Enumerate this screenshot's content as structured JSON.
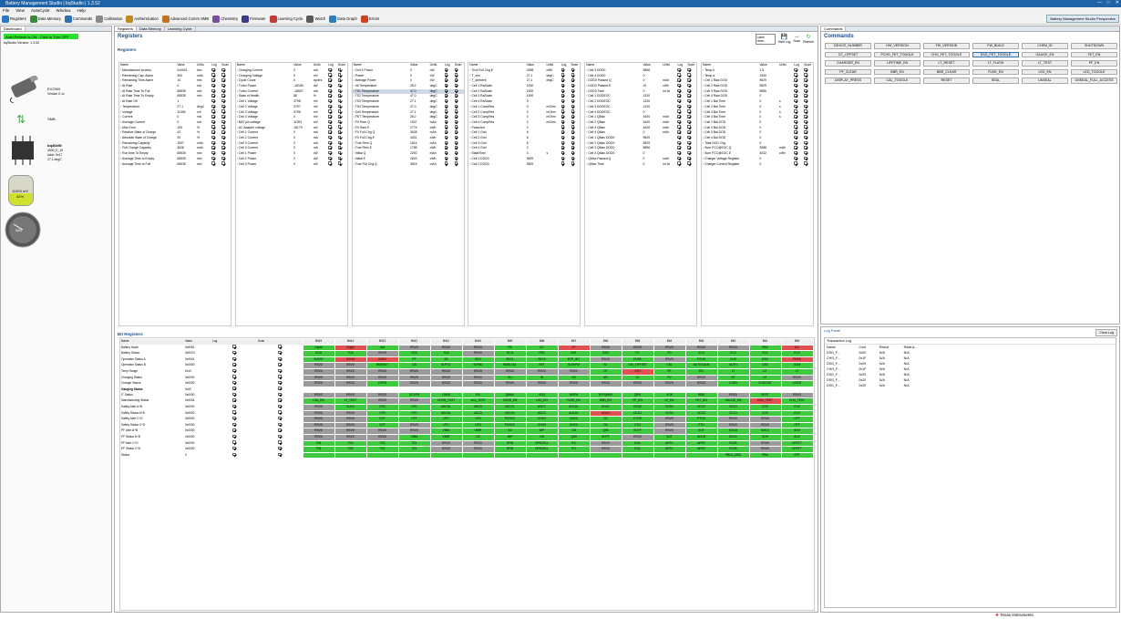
{
  "window": {
    "title": "Battery Management Studio | bqStudio | 1.3.52",
    "perspective": "Battery Management Studio Perspective"
  },
  "menu": [
    "File",
    "View",
    "AutoCycle",
    "Window",
    "Help"
  ],
  "toolbar": [
    {
      "label": "Registers",
      "color": "#2a78c8"
    },
    {
      "label": "Data Memory",
      "color": "#3b8a3b"
    },
    {
      "label": "Commands",
      "color": "#2f6fb0"
    },
    {
      "label": "Calibration",
      "color": "#8a8a8a"
    },
    {
      "label": "Authentication",
      "color": "#c08a1e"
    },
    {
      "label": "Advanced Comm SMB",
      "color": "#c07020"
    },
    {
      "label": "Chemistry",
      "color": "#7a4fa0"
    },
    {
      "label": "Firmware",
      "color": "#3a3a8a"
    },
    {
      "label": "Learning Cycle",
      "color": "#c03a3a"
    },
    {
      "label": "Watch",
      "color": "#5a5a5a"
    },
    {
      "label": "Data Graph",
      "color": "#2a80c0"
    },
    {
      "label": "Errors",
      "color": "#d04020"
    }
  ],
  "dashboard": {
    "tab": "Dashboard",
    "banner": "Auto Refresh is ON - Click to Turn OFF",
    "version": "bqStudio Version: 1.3.52",
    "device": "EV2300",
    "device_ver": "Version 0.1c",
    "smb": "SMB",
    "chip": "bq40z50",
    "chip_l1": "4500_0_15",
    "chip_l2": "Addr: 0x17",
    "chip_temp": "27.1 degC",
    "rsoc": "42%",
    "cap": "11393 mV",
    "gauge": "5000"
  },
  "main_tabs": [
    "Registers",
    "Data Memory",
    "Learning Cycle"
  ],
  "registers": {
    "title": "Registers",
    "section": "Registers",
    "bit_section": "Bit Registers",
    "actions": [
      "Label Here...",
      "Start Log",
      "Scan",
      "Refresh"
    ],
    "headers": [
      "Name",
      "Value",
      "Units",
      "Log",
      "Scan"
    ],
    "blocks": [
      [
        [
          "Manufacturer Access",
          "0x0041",
          "hex"
        ],
        [
          "Remaining Cap. Alarm",
          "300",
          "mAh"
        ],
        [
          "Remaining Time Alarm",
          "10",
          "min"
        ],
        [
          "At Rate",
          "0",
          "mA"
        ],
        [
          "At Rate Time To Full",
          "65535",
          "min"
        ],
        [
          "At Rate Time To Empty",
          "65535",
          "min"
        ],
        [
          "At Rate OK",
          "1",
          ""
        ],
        [
          "Temperature",
          "27.1",
          "degC"
        ],
        [
          "Voltage",
          "11394",
          "mV"
        ],
        [
          "Current",
          "0",
          "mA"
        ],
        [
          "Average Current",
          "0",
          "mA"
        ],
        [
          "Max Error",
          "100",
          "%"
        ],
        [
          "Relative State of Charge",
          "42",
          "%"
        ],
        [
          "Absolute State of Charge",
          "29",
          "%"
        ],
        [
          "Remaining Capacity",
          "1537",
          "mAh"
        ],
        [
          "Full Charge Capacity",
          "3628",
          "mAh"
        ],
        [
          "Run time To Empty",
          "65535",
          "min"
        ],
        [
          "Average Time to Empty",
          "65535",
          "min"
        ],
        [
          "Average Time to Full",
          "65535",
          "min"
        ]
      ],
      [
        [
          "Charging Current",
          "0",
          "mA"
        ],
        [
          "Charging Voltage",
          "0",
          "mV"
        ],
        [
          "Cycle Count",
          "0",
          "cycles"
        ],
        [
          "Turbo Power",
          "-15180",
          "cW"
        ],
        [
          "Turbo Current",
          "-16807",
          "mA"
        ],
        [
          "State of Health",
          "88",
          "%"
        ],
        [
          "Cell 1 Voltage",
          "3798",
          "mV"
        ],
        [
          "Cell 2 Voltage",
          "3797",
          "mV"
        ],
        [
          "Cell 3 Voltage",
          "3798",
          "mV"
        ],
        [
          "Cell 4 Voltage",
          "0",
          "mV"
        ],
        [
          "BAT pin voltage",
          "11391",
          "mV"
        ],
        [
          "AC Adapter voltage",
          "16179",
          "mV"
        ],
        [
          "Cell 1 Current",
          "0",
          "mA"
        ],
        [
          "Cell 2 Current",
          "0",
          "mA"
        ],
        [
          "Cell 3 Current",
          "0",
          "mA"
        ],
        [
          "Cell 4 Current",
          "0",
          "mA"
        ],
        [
          "Cell 1 Power",
          "0",
          "cW"
        ],
        [
          "Cell 2 Power",
          "0",
          "cW"
        ],
        [
          "Cell 3 Power",
          "0",
          "cW"
        ]
      ],
      [
        [
          "Cell 4 Power",
          "0",
          "cW"
        ],
        [
          "Power",
          "0",
          "cW"
        ],
        [
          "Average Power",
          "0",
          "cW"
        ],
        [
          "Int Temperature",
          "28.2",
          "degC"
        ],
        [
          "TS1 Temperature",
          "47.0",
          "degC"
        ],
        [
          "TS2 Temperature",
          "47.0",
          "degC"
        ],
        [
          "TS3 Temperature",
          "27.1",
          "degC"
        ],
        [
          "TS4 Temperature",
          "47.0",
          "degC"
        ],
        [
          "Cell Temperature",
          "27.1",
          "degC"
        ],
        [
          "FET Temperature",
          "28.2",
          "degC"
        ],
        [
          "FX Rem Q",
          "1537",
          "mAh"
        ],
        [
          "FX Rem E",
          "1774",
          "cWh"
        ],
        [
          "FX Full Chg Q",
          "3628",
          "mAh"
        ],
        [
          "FX Full Chg E",
          "4401",
          "cWh"
        ],
        [
          "True Rem Q",
          "1614",
          "mAh"
        ],
        [
          "True Rem E",
          "1755",
          "cWh"
        ],
        [
          "Initial Q",
          "2292",
          "mAh"
        ],
        [
          "Initial E",
          "2623",
          "cWh"
        ],
        [
          "True Full Chg Q",
          "3815",
          "mAh"
        ]
      ],
      [
        [
          "True Full Chg E",
          "4398",
          "cWh"
        ],
        [
          "T_sim",
          "27.1",
          "degC"
        ],
        [
          "T_ambient",
          "27.1",
          "degC"
        ],
        [
          "Cell 1 RaScale",
          "1000",
          ""
        ],
        [
          "Cell 2 RaScale",
          "1000",
          ""
        ],
        [
          "Cell 3 RaScale",
          "1000",
          ""
        ],
        [
          "Cell 4 RaScale",
          "0",
          ""
        ],
        [
          "Cell 1 CompRes",
          "0",
          "mOhm"
        ],
        [
          "Cell 2 CompRes",
          "0",
          "mOhm"
        ],
        [
          "Cell 3 CompRes",
          "0",
          "mOhm"
        ],
        [
          "Cell 4 CompRes",
          "0",
          "mOhm"
        ],
        [
          "Passchrd",
          "0",
          ""
        ],
        [
          "Cell 1 Grid",
          "6",
          ""
        ],
        [
          "Cell 2 Grid",
          "6",
          ""
        ],
        [
          "Cell 3 Grid",
          "6",
          ""
        ],
        [
          "Cell 4 Grid",
          "0",
          ""
        ],
        [
          "StateTime",
          "0",
          "s"
        ],
        [
          "Cell 1 DOD0",
          "9829",
          ""
        ],
        [
          "Cell 2 DOD0",
          "9829",
          ""
        ]
      ],
      [
        [
          "Cell 3 DOD0",
          "9856",
          ""
        ],
        [
          "Cell 4 DOD0",
          "0",
          ""
        ],
        [
          "DOD0 Passed Q",
          "0",
          "mAh"
        ],
        [
          "DOD0 Passed E",
          "10",
          "cWh"
        ],
        [
          "DOD0 Time",
          "0",
          "hr/16"
        ],
        [
          "Cell 1 DODEOC",
          "1320",
          ""
        ],
        [
          "Cell 2 DODEOC",
          "1320",
          ""
        ],
        [
          "Cell 3 DODEOC",
          "1320",
          ""
        ],
        [
          "Cell 4 DODEOC",
          "0",
          ""
        ],
        [
          "Cell 1 QMax",
          "4400",
          "mAh"
        ],
        [
          "Cell 2 QMax",
          "4400",
          "mAh"
        ],
        [
          "Cell 3 QMax",
          "4400",
          "mAh"
        ],
        [
          "Cell 4 QMax",
          "0",
          "mAh"
        ],
        [
          "Cell 1 QMax DOD0",
          "9829",
          ""
        ],
        [
          "Cell 2 QMax DOD0",
          "9829",
          ""
        ],
        [
          "Cell 3 QMax DOD0",
          "9856",
          ""
        ],
        [
          "Cell 4 QMax DOD0",
          "0",
          ""
        ],
        [
          "QMax Passed Q",
          "0",
          "mAh"
        ],
        [
          "QMax Time",
          "0",
          "hr/16"
        ]
      ],
      [
        [
          "Temp k",
          "1.5",
          ""
        ],
        [
          "Temp a",
          "1000",
          ""
        ],
        [
          "Cell 1 Raw DOD",
          "9829",
          ""
        ],
        [
          "Cell 2 Raw DOD",
          "9829",
          ""
        ],
        [
          "Cell 3 Raw DOD",
          "9856",
          ""
        ],
        [
          "Cell 4 Raw DOD",
          "0",
          ""
        ],
        [
          "Cell 1 Bal Time",
          "0",
          "s"
        ],
        [
          "Cell 2 Bal Time",
          "0",
          "s"
        ],
        [
          "Cell 3 Bal Time",
          "0",
          "s"
        ],
        [
          "Cell 4 Bal Time",
          "0",
          "s"
        ],
        [
          "Cell 1 Bal DOD",
          "0",
          ""
        ],
        [
          "Cell 2 Bal DOD",
          "0",
          ""
        ],
        [
          "Cell 3 Bal DOD",
          "0",
          ""
        ],
        [
          "Cell 4 Bal DOD",
          "0",
          ""
        ],
        [
          "Total DOD Chg",
          "0",
          ""
        ],
        [
          "Sum FCC@EOC Q",
          "3988",
          "mAh"
        ],
        [
          "Sum FCC@EOC E",
          "4032",
          "cWh"
        ],
        [
          "Charger Voltage Register",
          "0",
          ""
        ],
        [
          "Charger Current Register",
          "0",
          ""
        ]
      ]
    ],
    "bit_header": [
      "Name",
      "Value",
      "Log",
      "Scan",
      "Bit15",
      "Bit14",
      "Bit13",
      "Bit12",
      "Bit11",
      "Bit10",
      "Bit9",
      "Bit8",
      "Bit7",
      "Bit6",
      "Bit5",
      "Bit4",
      "Bit3",
      "Bit2",
      "Bit1",
      "Bit0"
    ],
    "bit_rows": [
      [
        "Battery Mode",
        "0x6081",
        "CapM g",
        "ChgM r",
        "AM",
        "RSVD",
        "RSVD",
        "RSVD",
        "PB",
        "CC",
        "CF r",
        "RSVD",
        "RSVD",
        "RSVD",
        "RSVD",
        "RSVD",
        "PBS",
        "ICC r"
      ],
      [
        "Battery Status",
        "0x00C0",
        "OCA",
        "TCA",
        "RSVD",
        "OTA",
        "TDA",
        "RSVD",
        "RCA",
        "RTA",
        "INIT",
        "DSG",
        "FC",
        "FD",
        "EC3",
        "EC2",
        "EC1",
        "EC0"
      ],
      [
        "Operation Status A",
        "0x0541",
        "SLEEP",
        "XCHG r",
        "XDSG r",
        "PF",
        "SS",
        "SDV",
        "SEC1",
        "SEC0",
        "BTP_INT",
        "RSVD",
        "FUSE",
        "RSVD",
        "PCHG",
        "CHG",
        "DSG",
        "PRES r"
      ],
      [
        "Operation Status B",
        "0x0000",
        "RSVD",
        "RSVD",
        "EMSHUT",
        "CB",
        "SLPCC",
        "SLPAD",
        "SMBLCAL",
        "INIT",
        "SLEEPM",
        "XL",
        "CAL_OFFSET",
        "CAL",
        "AUTOCALM",
        "AUTH",
        "LED",
        "SDM"
      ],
      [
        "Temp Range",
        "0x10",
        "RSVD",
        "RSVD",
        "RSVD",
        "RSVD",
        "RSVD",
        "RSVD",
        "RSVD",
        "RSVD",
        "RSVD",
        "OT",
        "STH r",
        "RT",
        "STL",
        "LT",
        "UT",
        "LT"
      ],
      [
        "Charging Status",
        "0x0000",
        "RSVD",
        "RSVD",
        "RSVD",
        "RSVD",
        "RSVD",
        "RSVD",
        "SU",
        "IN",
        "HV",
        "MV",
        "LV",
        "PV",
        "RSVD",
        "OT",
        "UT",
        "RSVD"
      ],
      [
        "Charger Status",
        "0x0000",
        "RSVD",
        "RSVD",
        "CHRG",
        "RSVD",
        "RSVD",
        "RSVD",
        "RSVD",
        "RSVD",
        "RSVD",
        "RSVD",
        "RSVD",
        "RSVD",
        "RSVD",
        "LOWV",
        "CHGSTAT",
        "CHGR"
      ],
      [
        "Gauging Status",
        "0x00",
        "",
        "",
        "",
        "",
        "",
        "",
        "",
        "",
        "",
        "",
        "",
        "",
        "",
        "",
        "",
        ""
      ],
      [
        "IT Status",
        "0x0000",
        "RSVD",
        "RSVD",
        "RSVD",
        "OCVFR",
        "LDMD",
        "RX",
        "QMAX",
        "VDQ",
        "NSFM",
        "SLPQMAX",
        "QEN",
        "VOK",
        "RDIS",
        "RSVD",
        "REST",
        "RSVD"
      ],
      [
        "Manufacturing Status",
        "0x0004",
        "CAL_EN",
        "LT_TEST",
        "RSVD",
        "RSVD",
        "CHGR_TEST",
        "ACL_TEST",
        "CHGR_EN",
        "LED_EN",
        "FUSE_EN",
        "BBR_EN",
        "PF_EN",
        "LF_EN",
        "FET_EN",
        "GAUGE_EN",
        "DSG_TEST r",
        "CHG_TEST"
      ],
      [
        "Safety Alert A+B",
        "0x0000",
        "RSVD",
        "CUVC",
        "OTD",
        "OTC",
        "ASCDL",
        "ASCD",
        "ASCCL",
        "ASCC",
        "AOLDL",
        "AOLD",
        "OCD2",
        "OCD1",
        "OCC2",
        "OCC1",
        "COV",
        "CUV"
      ],
      [
        "Safety Status A+B",
        "0x0000",
        "RSVD",
        "RSVD",
        "OTD",
        "OTC",
        "ASCDL",
        "ASCD",
        "ASCCL",
        "ASCC",
        "AOLDL",
        "AOLD r",
        "OCD2",
        "OCD1",
        "OCC2",
        "OCC1",
        "COV",
        "CUV"
      ],
      [
        "Safety Alert C+D",
        "0x0000",
        "RSVD",
        "RSVD",
        "COT",
        "HTF",
        "UTC",
        "UTD",
        "PCHGC",
        "CHGV",
        "CHGC",
        "OC",
        "CTOS",
        "RSVD",
        "PTOS",
        "RSVD",
        "RSVD",
        "OTF"
      ],
      [
        "Safety Status C+D",
        "0x0000",
        "RSVD",
        "RSVD",
        "COT",
        "RSVD",
        "UTC",
        "UTD",
        "PCHGC",
        "CHGV",
        "CHGC",
        "OC",
        "CTO",
        "RSVD",
        "PTO",
        "RSVD",
        "RSVD",
        "OTF"
      ],
      [
        "PF Alert A+B",
        "0x0000",
        "RSVD",
        "RSVD",
        "RSVD",
        "RSVD",
        "VIMA",
        "VIMR",
        "CD",
        "IMP",
        "CB",
        "QIM",
        "SOTF",
        "RSVD",
        "SOT",
        "SOCD",
        "SOCC",
        "SOV"
      ],
      [
        "PF Status A+B",
        "0x0000",
        "RSVD",
        "RSVD",
        "RSVD",
        "VIMA",
        "VIMR",
        "CD",
        "IMP",
        "CB",
        "QIM",
        "SOTF",
        "RSVD",
        "SOT",
        "SOCD",
        "SOCC",
        "SOV",
        "SUV"
      ],
      [
        "PF Alert C+D",
        "0x0000",
        "TS4",
        "TS3",
        "TS2",
        "TS1",
        "RSVD",
        "RSVD",
        "DFW",
        "OPNCELL",
        "IFC",
        "RSVD",
        "2LVL",
        "AFEC",
        "AFER",
        "FUSE",
        "RSVD",
        "DFETF"
      ],
      [
        "PF Status C+D",
        "0x0000",
        "TS4",
        "TS3",
        "TS2",
        "TS1",
        "RSVD",
        "RSVD",
        "DFW",
        "OPNCELL",
        "IFC",
        "RSVD",
        "2LVL",
        "AFEC",
        "AFER",
        "FUSE",
        "RSVD",
        "DFETF"
      ],
      [
        "Status",
        "0",
        "",
        "",
        "",
        "",
        "",
        "",
        "",
        "",
        "",
        "",
        "",
        "",
        "",
        "PBLO_DBG",
        "PBA",
        "EFF"
      ]
    ]
  },
  "commands": {
    "title": "Commands",
    "items": [
      "DEVICE_NUMBER",
      "HW_VERSION",
      "FW_VERSION",
      "FW_BUILD",
      "CHEM_ID",
      "SHUTDOWN",
      "CC_OFFSET",
      "PCHG_FET_TOGGLE",
      "CHG_FET_TOGGLE",
      "DSG_FET_TOGGLE",
      "GAUGE_EN",
      "FET_EN",
      "CHARGER_EN",
      "LIFETIME_EN",
      "LT_RESET",
      "LT_FLUSH",
      "LT_TEST",
      "PF_EN",
      "PF_CLEAR",
      "BBR_EN",
      "BBR_CLEAR",
      "FUSE_EN",
      "LED_EN",
      "LED_TOGGLE",
      "DISPLAY_PRESS",
      "CAL_TOGGLE",
      "RESET",
      "SEAL",
      "UNSEAL",
      "UNSEAL_FULL_ACCESS"
    ],
    "selected": "DSG_FET_TOGGLE"
  },
  "log": {
    "title": "Log Panel",
    "clear": "Clear Log",
    "section": "Transaction Log",
    "headers": [
      "Name",
      "Cmd",
      "Result",
      "Read A..."
    ],
    "rows": [
      [
        "DSG_F...",
        "0x20",
        "N/A",
        "N/A"
      ],
      [
        "CHG_F...",
        "0x1F",
        "N/A",
        "N/A"
      ],
      [
        "DSG_F...",
        "0x20",
        "N/A",
        "N/A"
      ],
      [
        "CHG_F...",
        "0x1F",
        "N/A",
        "N/A"
      ],
      [
        "DSG_F...",
        "0x20",
        "N/A",
        "N/A"
      ],
      [
        "DSG_F...",
        "0x20",
        "N/A",
        "N/A"
      ],
      [
        "DSG_F...",
        "0x20",
        "N/A",
        "N/A"
      ]
    ]
  },
  "footer": {
    "brand": "Texas Instruments"
  }
}
